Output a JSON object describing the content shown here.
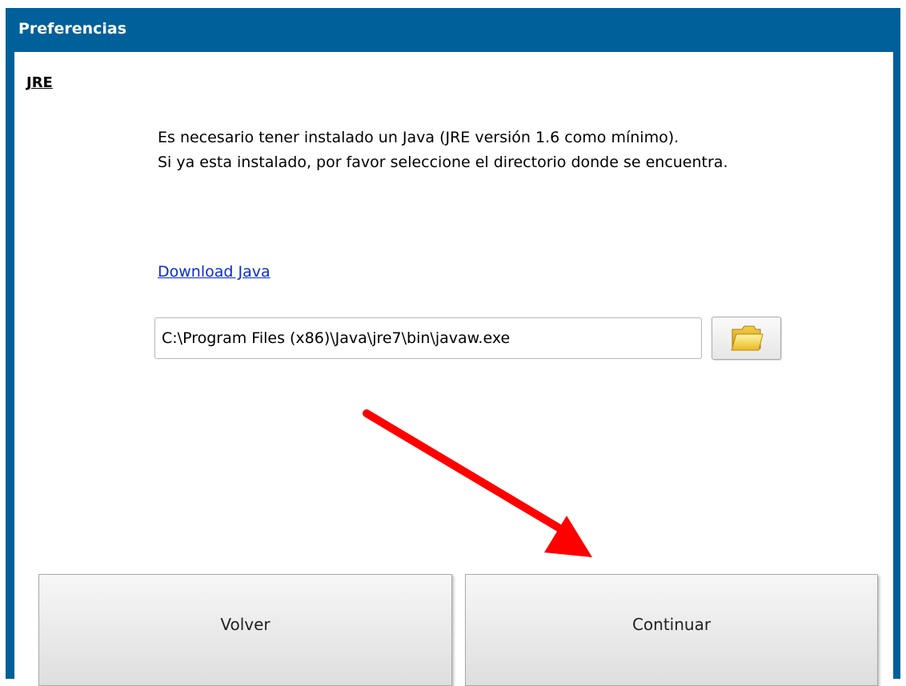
{
  "window": {
    "title": "Preferencias"
  },
  "section": {
    "title": "JRE"
  },
  "info": {
    "line1": "Es necesario tener instalado un Java (JRE versión 1.6 como mínimo).",
    "line2": " Si ya esta instalado, por favor seleccione el directorio donde se encuentra."
  },
  "download_link": {
    "label": "Download Java"
  },
  "path_field": {
    "value": "C:\\Program Files (x86)\\Java\\jre7\\bin\\javaw.exe",
    "browse_icon": "folder-icon"
  },
  "buttons": {
    "back_label": "Volver",
    "continue_label": "Continuar"
  },
  "annotation": {
    "icon": "red-arrow-icon",
    "color": "#ff0000"
  },
  "colors": {
    "titlebar": "#00609a",
    "link": "#0b2bd6"
  }
}
